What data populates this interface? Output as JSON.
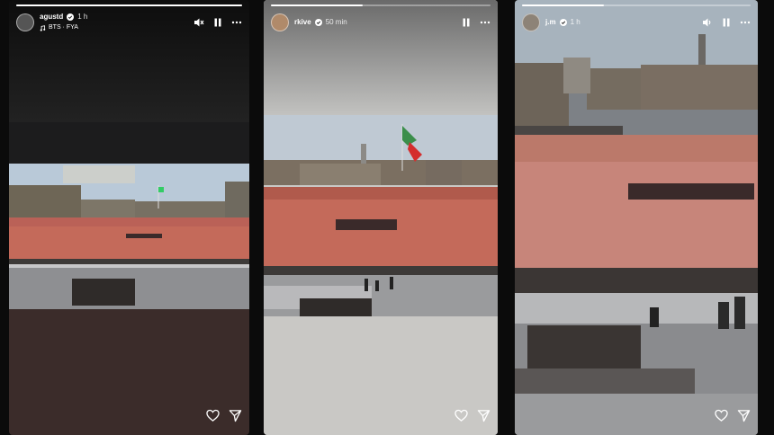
{
  "stories": [
    {
      "username": "agustd",
      "time": "1 h",
      "music": "BTS · FYA",
      "progress": 1.0,
      "controls": [
        "mute-icon",
        "pause-icon",
        "more-icon"
      ],
      "footer": [
        "heart-icon",
        "send-icon"
      ]
    },
    {
      "username": "rkive",
      "time": "50 min",
      "progress": 0.42,
      "controls": [
        "pause-icon",
        "more-icon"
      ],
      "footer": [
        "heart-icon",
        "send-icon"
      ]
    },
    {
      "username": "j.m",
      "time": "1 h",
      "progress": 0.36,
      "controls": [
        "sound-icon",
        "pause-icon",
        "more-icon"
      ],
      "footer": [
        "heart-icon",
        "send-icon"
      ]
    }
  ],
  "colors": {
    "background": "#0b0b0b",
    "crowd": "#c46a5a",
    "sky": "#a9bdd0",
    "pavement": "#8e8f92",
    "story1_bottom": "#3b2c2a",
    "story2_bottom": "#c9c8c5"
  }
}
